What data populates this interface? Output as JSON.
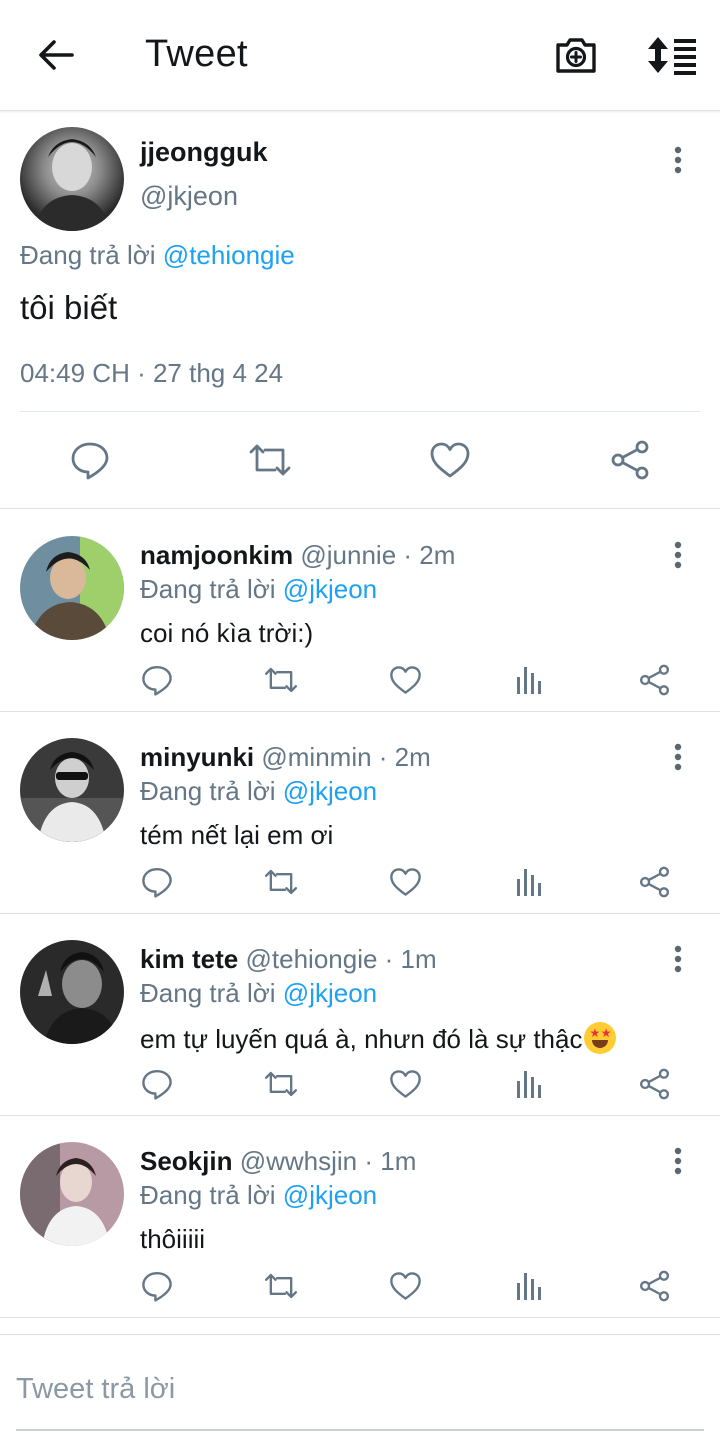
{
  "header": {
    "title": "Tweet",
    "back_icon": "arrow-left-icon",
    "camera_icon": "camera-plus-icon",
    "sort_icon": "sort-list-icon"
  },
  "main_tweet": {
    "display_name": "jjeongguk",
    "handle": "@jkjeon",
    "replying_prefix": "Đang trả lời",
    "replying_to": "@tehiongie",
    "text": "tôi biết",
    "timestamp": "04:49 CH · 27 thg 4 24",
    "actions": [
      "reply-icon",
      "retweet-icon",
      "like-icon",
      "share-icon"
    ]
  },
  "replies": [
    {
      "display_name": "namjoonkim",
      "handle": "@junnie",
      "time": " · 2m",
      "replying_prefix": "Đang trả lời",
      "replying_to": "@jkjeon",
      "text": "coi nó kìa trời:)"
    },
    {
      "display_name": "minyunki",
      "handle": "@minmin",
      "time": " · 2m",
      "replying_prefix": "Đang trả lời",
      "replying_to": "@jkjeon",
      "text": "tém nết lại em ơi"
    },
    {
      "display_name": "kim tete",
      "handle": "@tehiongie",
      "time": " · 1m",
      "replying_prefix": "Đang trả lời",
      "replying_to": "@jkjeon",
      "text": "em tự luyến quá à, nhưn đó là sự thậc",
      "emoji": "star-struck-emoji"
    },
    {
      "display_name": "Seokjin",
      "handle": "@wwhsjin",
      "time": " · 1m",
      "replying_prefix": "Đang trả lời",
      "replying_to": "@jkjeon",
      "text": "thôiiiii"
    }
  ],
  "composer": {
    "placeholder": "Tweet trả lời"
  },
  "colors": {
    "accent": "#1da1f2",
    "secondary_text": "#657786",
    "primary_text": "#14171a",
    "divider": "#dfe3e6"
  }
}
